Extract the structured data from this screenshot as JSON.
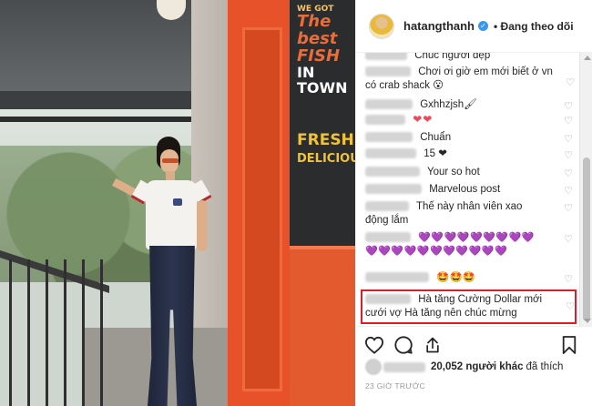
{
  "post": {
    "username": "hatangthanh",
    "follow_status": "• Đang theo dõi",
    "photo_sign": [
      "WE GOT",
      "The best",
      "FISH",
      "IN TOWN",
      "FRESH",
      "DELICIOUS"
    ]
  },
  "comments": [
    {
      "user": "xxxxxxx",
      "text": "Chúc người đẹp"
    },
    {
      "user": "xxxxxxxxxx",
      "text": "Chơi ơi giờ em mới biết ở vn có crab shack 😮"
    },
    {
      "user": "xxxxxxxxxxx",
      "text": "Gxhhzjsh🖌"
    },
    {
      "user": "xxxxxxxxxx",
      "text": "❤❤"
    },
    {
      "user": "xxxxxxxxxxx",
      "text": "Chuẩn"
    },
    {
      "user": "xxxxxxxxxx",
      "text": "15 ❤"
    },
    {
      "user": "xxxxxxxxxxxxx",
      "text": "Your so hot"
    },
    {
      "user": "xxxxxxxxxxxxx",
      "text": "Marvelous post"
    },
    {
      "user": "xxxxxxxxxx",
      "text": "Thế này nhân viên xao động lắm"
    },
    {
      "user": "xxxxxxxxxxxx",
      "text": "💜💜💜💜💜💜💜💜💜💜💜💜💜💜💜💜💜💜💜💜"
    },
    {
      "user": "xxxxxxxxx",
      "text": "🤩🤩🤩"
    },
    {
      "user": "xxxxxxxxx",
      "text": "Hà tăng Cường Dollar mới cưới vợ Hà tăng nên chúc mừng"
    }
  ],
  "likes": {
    "count_text": "20,052 người khác",
    "suffix": "đã thích"
  },
  "timestamp": "23 GIỜ TRƯỚC",
  "icons": [
    "heart-icon",
    "comment-icon",
    "share-icon",
    "bookmark-icon",
    "verified-icon"
  ],
  "colors": {
    "highlight": "#e31b23",
    "verified": "#3897f0",
    "heart": "#ed4956"
  }
}
